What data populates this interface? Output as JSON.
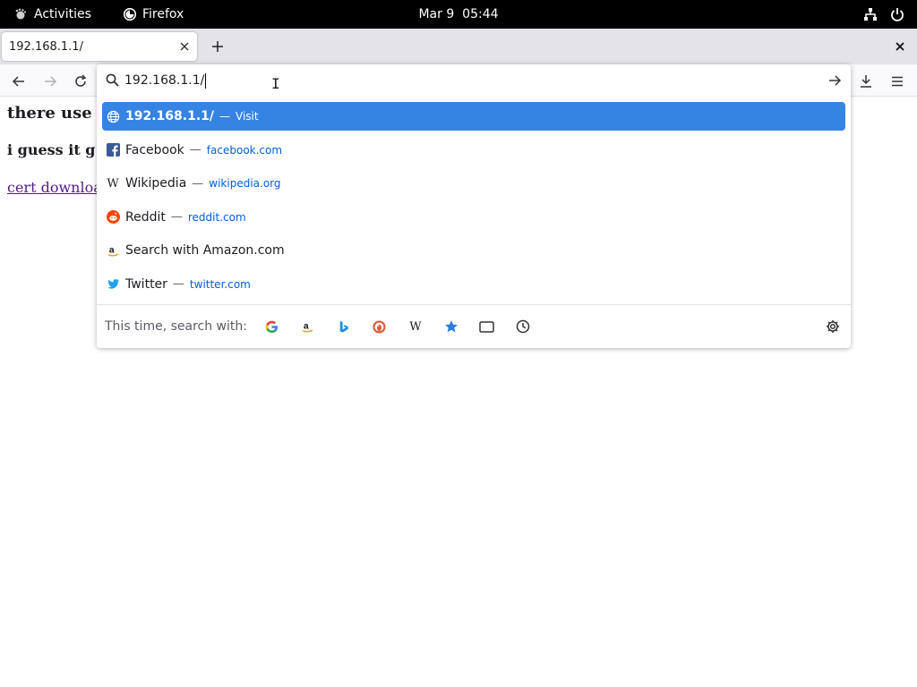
{
  "topbar": {
    "activities": "Activities",
    "app_name": "Firefox",
    "date": "Mar 9",
    "time": "05:44",
    "tray_icons": [
      "network-icon",
      "power-icon"
    ]
  },
  "tab": {
    "title": "192.168.1.1/"
  },
  "page": {
    "line1": "there use",
    "line2": "i guess it g",
    "link": "cert downloa"
  },
  "urlbar": {
    "value": "192.168.1.1/",
    "results": [
      {
        "icon": "globe-icon",
        "title": "192.168.1.1/",
        "action": "Visit",
        "selected": true
      },
      {
        "icon": "facebook-icon",
        "title": "Facebook",
        "url": "facebook.com"
      },
      {
        "icon": "wikipedia-icon",
        "title": "Wikipedia",
        "url": "wikipedia.org"
      },
      {
        "icon": "reddit-icon",
        "title": "Reddit",
        "url": "reddit.com"
      },
      {
        "icon": "amazon-icon",
        "title": "Search with Amazon.com"
      },
      {
        "icon": "twitter-icon",
        "title": "Twitter",
        "url": "twitter.com"
      }
    ],
    "dash": "—",
    "oneoff_label": "This time, search with:",
    "engines": [
      "google-icon",
      "amazon-icon",
      "bing-icon",
      "duckduckgo-icon",
      "wikipedia-icon",
      "bookmarks-icon",
      "tabs-icon",
      "history-icon"
    ]
  },
  "colors": {
    "selection": "#3584e4",
    "link_url": "#0061e0",
    "visited_link": "#551a8b"
  }
}
